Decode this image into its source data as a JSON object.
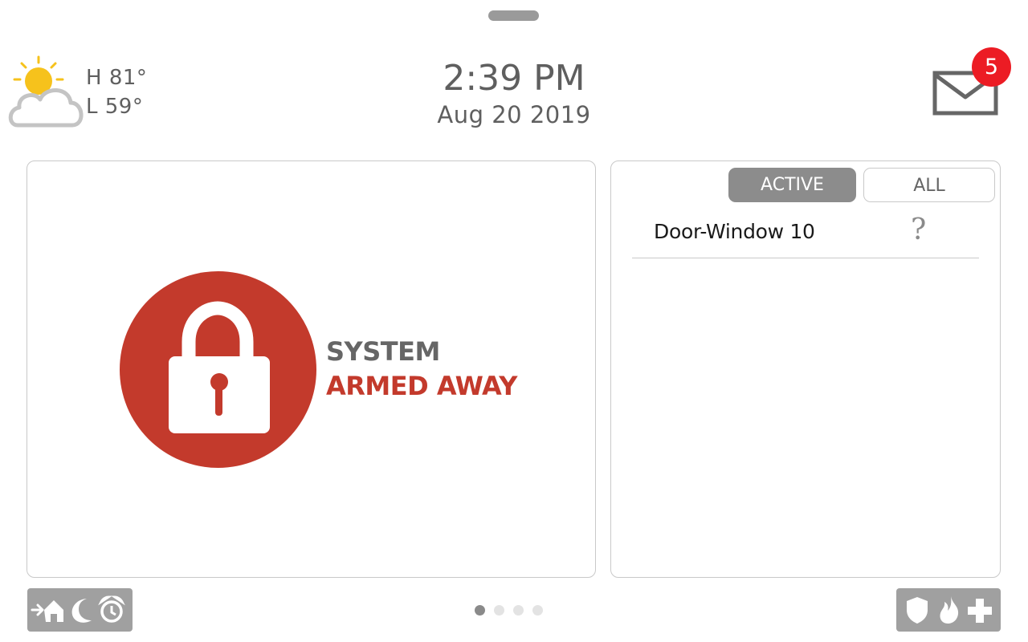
{
  "weather": {
    "high": "H 81°",
    "low": "L 59°",
    "icon": "partly-cloudy-icon"
  },
  "clock": {
    "time": "2:39 PM",
    "date": "Aug 20 2019"
  },
  "messages": {
    "icon": "mail-icon",
    "unread_count": "5",
    "badge_color": "#ec1c24"
  },
  "system_status": {
    "line1": "SYSTEM",
    "line2": "ARMED AWAY",
    "icon": "lock-icon",
    "status_color": "#c33a2c"
  },
  "sensors": {
    "tabs": [
      {
        "label": "ACTIVE",
        "selected": true
      },
      {
        "label": "ALL",
        "selected": false
      }
    ],
    "rows": [
      {
        "name": "Door-Window 10",
        "status": "?"
      }
    ]
  },
  "arming_bar": {
    "icons": [
      "arm-stay-icon",
      "arm-night-icon",
      "alarm-clock-icon"
    ]
  },
  "emergency_bar": {
    "icons": [
      "police-shield-icon",
      "fire-icon",
      "medical-cross-icon"
    ]
  },
  "pages": {
    "count": 4,
    "current": 1
  }
}
